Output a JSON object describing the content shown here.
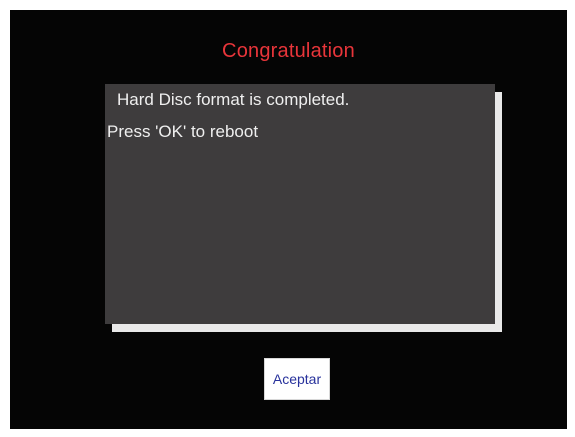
{
  "dialog": {
    "title": "Congratulation",
    "message_line_1": "Hard Disc format is completed.",
    "message_line_2": "Press 'OK' to reboot",
    "accept_label": "Aceptar"
  },
  "colors": {
    "background": "#050505",
    "title": "#e8353a",
    "panel": "#3e3c3d",
    "panel_shadow": "#e9e9e9",
    "message_text": "#efefef",
    "button_bg": "#ffffff",
    "button_text": "#28329c"
  }
}
